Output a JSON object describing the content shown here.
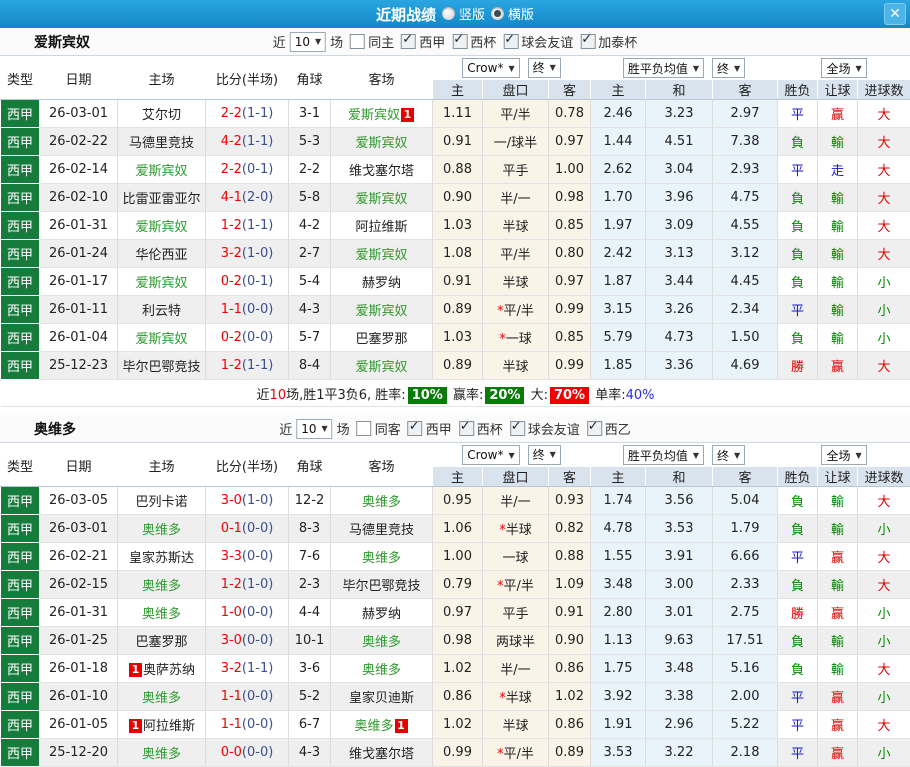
{
  "titlebar": {
    "title": "近期战绩",
    "radios": [
      {
        "label": "竖版",
        "checked": false
      },
      {
        "label": "横版",
        "checked": true
      }
    ],
    "close_glyph": "✕"
  },
  "columns": {
    "main": [
      "类型",
      "日期",
      "主场",
      "比分(半场)",
      "角球",
      "客场"
    ],
    "sub": [
      "主",
      "盘口",
      "客",
      "主",
      "和",
      "客",
      "胜负",
      "让球",
      "进球数"
    ],
    "selects": {
      "bookmaker": "Crow*",
      "odds_final": "终",
      "avg": "胜平负均值",
      "avg_final": "终",
      "scope": "全场"
    }
  },
  "filter_words": {
    "near": "近",
    "count": "10",
    "games": "场"
  },
  "colors": {
    "team_green": "#2e9b2e",
    "league_bg_green": "#157c3c",
    "score_red": "#f20000",
    "score_half_blue": "#3c4f8f",
    "result_red": "#e10000",
    "result_blue": "#1515d0",
    "result_green": "#018a01",
    "badge_red": "#e80000",
    "rate_badge_green": "#077d07",
    "rate_badge_red": "#f00000",
    "rate_blue": "#2a2af0"
  },
  "sections": [
    {
      "team": "爱斯宾奴",
      "filters": {
        "same": {
          "label": "同主",
          "checked": false
        },
        "comps": [
          {
            "label": "西甲",
            "checked": true
          },
          {
            "label": "西杯",
            "checked": true
          },
          {
            "label": "球会友谊",
            "checked": true
          },
          {
            "label": "加泰杯",
            "checked": true
          }
        ]
      },
      "rows": [
        {
          "league": "西甲",
          "date": "26-03-01",
          "home": "艾尔切",
          "home_is_team": false,
          "home_badge": "",
          "score": "2-2",
          "half": "(1-1)",
          "corner": "3-1",
          "away": "爱斯宾奴",
          "away_is_team": true,
          "away_badge": "1",
          "odds_home": "1.11",
          "handicap": "平/半",
          "star": false,
          "odds_away": "0.78",
          "avg_home": "2.46",
          "avg_draw": "3.23",
          "avg_away": "2.97",
          "results": [
            {
              "text": "平",
              "color": "blue"
            },
            {
              "text": "赢",
              "color": "red"
            },
            {
              "text": "大",
              "color": "red"
            }
          ]
        },
        {
          "league": "西甲",
          "date": "26-02-22",
          "home": "马德里竞技",
          "home_is_team": false,
          "home_badge": "",
          "score": "4-2",
          "half": "(1-1)",
          "corner": "5-3",
          "away": "爱斯宾奴",
          "away_is_team": true,
          "away_badge": "",
          "odds_home": "0.91",
          "handicap": "一/球半",
          "star": false,
          "odds_away": "0.97",
          "avg_home": "1.44",
          "avg_draw": "4.51",
          "avg_away": "7.38",
          "results": [
            {
              "text": "負",
              "color": "green"
            },
            {
              "text": "輸",
              "color": "green"
            },
            {
              "text": "大",
              "color": "red"
            }
          ]
        },
        {
          "league": "西甲",
          "date": "26-02-14",
          "home": "爱斯宾奴",
          "home_is_team": true,
          "home_badge": "",
          "score": "2-2",
          "half": "(0-1)",
          "corner": "2-2",
          "away": "维戈塞尔塔",
          "away_is_team": false,
          "away_badge": "",
          "odds_home": "0.88",
          "handicap": "平手",
          "star": false,
          "odds_away": "1.00",
          "avg_home": "2.62",
          "avg_draw": "3.04",
          "avg_away": "2.93",
          "results": [
            {
              "text": "平",
              "color": "blue"
            },
            {
              "text": "走",
              "color": "blue"
            },
            {
              "text": "大",
              "color": "red"
            }
          ]
        },
        {
          "league": "西甲",
          "date": "26-02-10",
          "home": "比雷亚雷亚尔",
          "home_is_team": false,
          "home_badge": "",
          "score": "4-1",
          "half": "(2-0)",
          "corner": "5-8",
          "away": "爱斯宾奴",
          "away_is_team": true,
          "away_badge": "",
          "odds_home": "0.90",
          "handicap": "半/一",
          "star": false,
          "odds_away": "0.98",
          "avg_home": "1.70",
          "avg_draw": "3.96",
          "avg_away": "4.75",
          "results": [
            {
              "text": "負",
              "color": "green"
            },
            {
              "text": "輸",
              "color": "green"
            },
            {
              "text": "大",
              "color": "red"
            }
          ]
        },
        {
          "league": "西甲",
          "date": "26-01-31",
          "home": "爱斯宾奴",
          "home_is_team": true,
          "home_badge": "",
          "score": "1-2",
          "half": "(1-1)",
          "corner": "4-2",
          "away": "阿拉维斯",
          "away_is_team": false,
          "away_badge": "",
          "odds_home": "1.03",
          "handicap": "半球",
          "star": false,
          "odds_away": "0.85",
          "avg_home": "1.97",
          "avg_draw": "3.09",
          "avg_away": "4.55",
          "results": [
            {
              "text": "負",
              "color": "green"
            },
            {
              "text": "輸",
              "color": "green"
            },
            {
              "text": "大",
              "color": "red"
            }
          ]
        },
        {
          "league": "西甲",
          "date": "26-01-24",
          "home": "华伦西亚",
          "home_is_team": false,
          "home_badge": "",
          "score": "3-2",
          "half": "(1-0)",
          "corner": "2-7",
          "away": "爱斯宾奴",
          "away_is_team": true,
          "away_badge": "",
          "odds_home": "1.08",
          "handicap": "平/半",
          "star": false,
          "odds_away": "0.80",
          "avg_home": "2.42",
          "avg_draw": "3.13",
          "avg_away": "3.12",
          "results": [
            {
              "text": "負",
              "color": "green"
            },
            {
              "text": "輸",
              "color": "green"
            },
            {
              "text": "大",
              "color": "red"
            }
          ]
        },
        {
          "league": "西甲",
          "date": "26-01-17",
          "home": "爱斯宾奴",
          "home_is_team": true,
          "home_badge": "",
          "score": "0-2",
          "half": "(0-1)",
          "corner": "5-4",
          "away": "赫罗纳",
          "away_is_team": false,
          "away_badge": "",
          "odds_home": "0.91",
          "handicap": "半球",
          "star": false,
          "odds_away": "0.97",
          "avg_home": "1.87",
          "avg_draw": "3.44",
          "avg_away": "4.45",
          "results": [
            {
              "text": "負",
              "color": "green"
            },
            {
              "text": "輸",
              "color": "green"
            },
            {
              "text": "小",
              "color": "green"
            }
          ]
        },
        {
          "league": "西甲",
          "date": "26-01-11",
          "home": "利云特",
          "home_is_team": false,
          "home_badge": "",
          "score": "1-1",
          "half": "(0-0)",
          "corner": "4-3",
          "away": "爱斯宾奴",
          "away_is_team": true,
          "away_badge": "",
          "odds_home": "0.89",
          "handicap": "平/半",
          "star": true,
          "odds_away": "0.99",
          "avg_home": "3.15",
          "avg_draw": "3.26",
          "avg_away": "2.34",
          "results": [
            {
              "text": "平",
              "color": "blue"
            },
            {
              "text": "輸",
              "color": "green"
            },
            {
              "text": "小",
              "color": "green"
            }
          ]
        },
        {
          "league": "西甲",
          "date": "26-01-04",
          "home": "爱斯宾奴",
          "home_is_team": true,
          "home_badge": "",
          "score": "0-2",
          "half": "(0-0)",
          "corner": "5-7",
          "away": "巴塞罗那",
          "away_is_team": false,
          "away_badge": "",
          "odds_home": "1.03",
          "handicap": "一球",
          "star": true,
          "odds_away": "0.85",
          "avg_home": "5.79",
          "avg_draw": "4.73",
          "avg_away": "1.50",
          "results": [
            {
              "text": "負",
              "color": "green"
            },
            {
              "text": "輸",
              "color": "green"
            },
            {
              "text": "小",
              "color": "green"
            }
          ]
        },
        {
          "league": "西甲",
          "date": "25-12-23",
          "home": "毕尔巴鄂竞技",
          "home_is_team": false,
          "home_badge": "",
          "score": "1-2",
          "half": "(1-1)",
          "corner": "8-4",
          "away": "爱斯宾奴",
          "away_is_team": true,
          "away_badge": "",
          "odds_home": "0.89",
          "handicap": "半球",
          "star": false,
          "odds_away": "0.99",
          "avg_home": "1.85",
          "avg_draw": "3.36",
          "avg_away": "4.69",
          "results": [
            {
              "text": "勝",
              "color": "red"
            },
            {
              "text": "赢",
              "color": "red"
            },
            {
              "text": "大",
              "color": "red"
            }
          ]
        }
      ],
      "summary": [
        {
          "text": "近",
          "style": "plain"
        },
        {
          "text": "10",
          "style": "red"
        },
        {
          "text": "场,胜1平3负6, 胜率:",
          "style": "plain"
        },
        {
          "text": "10%",
          "style": "badge-green"
        },
        {
          "text": " 赢率:",
          "style": "plain"
        },
        {
          "text": "20%",
          "style": "badge-green"
        },
        {
          "text": " 大:",
          "style": "plain"
        },
        {
          "text": "70%",
          "style": "badge-red"
        },
        {
          "text": " 单率:",
          "style": "plain"
        },
        {
          "text": "40%",
          "style": "blue"
        }
      ]
    },
    {
      "team": "奥维多",
      "filters": {
        "same": {
          "label": "同客",
          "checked": false
        },
        "comps": [
          {
            "label": "西甲",
            "checked": true
          },
          {
            "label": "西杯",
            "checked": true
          },
          {
            "label": "球会友谊",
            "checked": true
          },
          {
            "label": "西乙",
            "checked": true
          }
        ]
      },
      "rows": [
        {
          "league": "西甲",
          "date": "26-03-05",
          "home": "巴列卡诺",
          "home_is_team": false,
          "home_badge": "",
          "score": "3-0",
          "half": "(1-0)",
          "corner": "12-2",
          "away": "奥维多",
          "away_is_team": true,
          "away_badge": "",
          "odds_home": "0.95",
          "handicap": "半/一",
          "star": false,
          "odds_away": "0.93",
          "avg_home": "1.74",
          "avg_draw": "3.56",
          "avg_away": "5.04",
          "results": [
            {
              "text": "負",
              "color": "green"
            },
            {
              "text": "輸",
              "color": "green"
            },
            {
              "text": "大",
              "color": "red"
            }
          ]
        },
        {
          "league": "西甲",
          "date": "26-03-01",
          "home": "奥维多",
          "home_is_team": true,
          "home_badge": "",
          "score": "0-1",
          "half": "(0-0)",
          "corner": "8-3",
          "away": "马德里竞技",
          "away_is_team": false,
          "away_badge": "",
          "odds_home": "1.06",
          "handicap": "半球",
          "star": true,
          "odds_away": "0.82",
          "avg_home": "4.78",
          "avg_draw": "3.53",
          "avg_away": "1.79",
          "results": [
            {
              "text": "負",
              "color": "green"
            },
            {
              "text": "輸",
              "color": "green"
            },
            {
              "text": "小",
              "color": "green"
            }
          ]
        },
        {
          "league": "西甲",
          "date": "26-02-21",
          "home": "皇家苏斯达",
          "home_is_team": false,
          "home_badge": "",
          "score": "3-3",
          "half": "(0-0)",
          "corner": "7-6",
          "away": "奥维多",
          "away_is_team": true,
          "away_badge": "",
          "odds_home": "1.00",
          "handicap": "一球",
          "star": false,
          "odds_away": "0.88",
          "avg_home": "1.55",
          "avg_draw": "3.91",
          "avg_away": "6.66",
          "results": [
            {
              "text": "平",
              "color": "blue"
            },
            {
              "text": "赢",
              "color": "red"
            },
            {
              "text": "大",
              "color": "red"
            }
          ]
        },
        {
          "league": "西甲",
          "date": "26-02-15",
          "home": "奥维多",
          "home_is_team": true,
          "home_badge": "",
          "score": "1-2",
          "half": "(1-0)",
          "corner": "2-3",
          "away": "毕尔巴鄂竞技",
          "away_is_team": false,
          "away_badge": "",
          "odds_home": "0.79",
          "handicap": "平/半",
          "star": true,
          "odds_away": "1.09",
          "avg_home": "3.48",
          "avg_draw": "3.00",
          "avg_away": "2.33",
          "results": [
            {
              "text": "負",
              "color": "green"
            },
            {
              "text": "輸",
              "color": "green"
            },
            {
              "text": "大",
              "color": "red"
            }
          ]
        },
        {
          "league": "西甲",
          "date": "26-01-31",
          "home": "奥维多",
          "home_is_team": true,
          "home_badge": "",
          "score": "1-0",
          "half": "(0-0)",
          "corner": "4-4",
          "away": "赫罗纳",
          "away_is_team": false,
          "away_badge": "",
          "odds_home": "0.97",
          "handicap": "平手",
          "star": false,
          "odds_away": "0.91",
          "avg_home": "2.80",
          "avg_draw": "3.01",
          "avg_away": "2.75",
          "results": [
            {
              "text": "勝",
              "color": "red"
            },
            {
              "text": "赢",
              "color": "red"
            },
            {
              "text": "小",
              "color": "green"
            }
          ]
        },
        {
          "league": "西甲",
          "date": "26-01-25",
          "home": "巴塞罗那",
          "home_is_team": false,
          "home_badge": "",
          "score": "3-0",
          "half": "(0-0)",
          "corner": "10-1",
          "away": "奥维多",
          "away_is_team": true,
          "away_badge": "",
          "odds_home": "0.98",
          "handicap": "两球半",
          "star": false,
          "odds_away": "0.90",
          "avg_home": "1.13",
          "avg_draw": "9.63",
          "avg_away": "17.51",
          "results": [
            {
              "text": "負",
              "color": "green"
            },
            {
              "text": "輸",
              "color": "green"
            },
            {
              "text": "小",
              "color": "green"
            }
          ]
        },
        {
          "league": "西甲",
          "date": "26-01-18",
          "home": "奥萨苏纳",
          "home_is_team": false,
          "home_badge": "1",
          "score": "3-2",
          "half": "(1-1)",
          "corner": "3-6",
          "away": "奥维多",
          "away_is_team": true,
          "away_badge": "",
          "odds_home": "1.02",
          "handicap": "半/一",
          "star": false,
          "odds_away": "0.86",
          "avg_home": "1.75",
          "avg_draw": "3.48",
          "avg_away": "5.16",
          "results": [
            {
              "text": "負",
              "color": "green"
            },
            {
              "text": "輸",
              "color": "green"
            },
            {
              "text": "大",
              "color": "red"
            }
          ]
        },
        {
          "league": "西甲",
          "date": "26-01-10",
          "home": "奥维多",
          "home_is_team": true,
          "home_badge": "",
          "score": "1-1",
          "half": "(0-0)",
          "corner": "5-2",
          "away": "皇家贝迪斯",
          "away_is_team": false,
          "away_badge": "",
          "odds_home": "0.86",
          "handicap": "半球",
          "star": true,
          "odds_away": "1.02",
          "avg_home": "3.92",
          "avg_draw": "3.38",
          "avg_away": "2.00",
          "results": [
            {
              "text": "平",
              "color": "blue"
            },
            {
              "text": "赢",
              "color": "red"
            },
            {
              "text": "小",
              "color": "green"
            }
          ]
        },
        {
          "league": "西甲",
          "date": "26-01-05",
          "home": "阿拉维斯",
          "home_is_team": false,
          "home_badge": "1",
          "score": "1-1",
          "half": "(0-0)",
          "corner": "6-7",
          "away": "奥维多",
          "away_is_team": true,
          "away_badge": "1",
          "odds_home": "1.02",
          "handicap": "半球",
          "star": false,
          "odds_away": "0.86",
          "avg_home": "1.91",
          "avg_draw": "2.96",
          "avg_away": "5.22",
          "results": [
            {
              "text": "平",
              "color": "blue"
            },
            {
              "text": "赢",
              "color": "red"
            },
            {
              "text": "大",
              "color": "red"
            }
          ]
        },
        {
          "league": "西甲",
          "date": "25-12-20",
          "home": "奥维多",
          "home_is_team": true,
          "home_badge": "",
          "score": "0-0",
          "half": "(0-0)",
          "corner": "4-3",
          "away": "维戈塞尔塔",
          "away_is_team": false,
          "away_badge": "",
          "odds_home": "0.99",
          "handicap": "平/半",
          "star": true,
          "odds_away": "0.89",
          "avg_home": "3.53",
          "avg_draw": "3.22",
          "avg_away": "2.18",
          "results": [
            {
              "text": "平",
              "color": "blue"
            },
            {
              "text": "赢",
              "color": "red"
            },
            {
              "text": "小",
              "color": "green"
            }
          ]
        }
      ],
      "summary": null
    }
  ]
}
